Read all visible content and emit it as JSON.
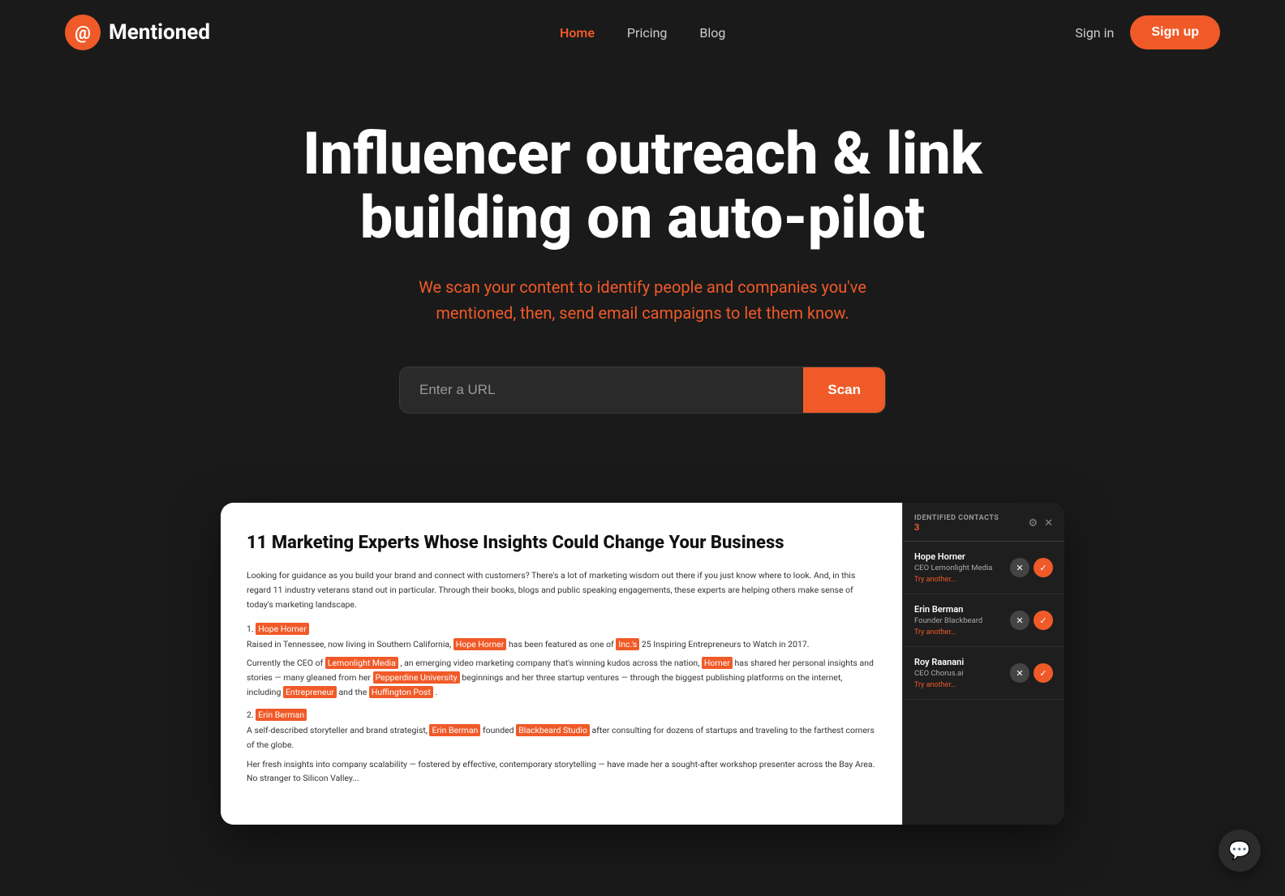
{
  "brand": {
    "logo_text": "Mentioned",
    "logo_icon_color": "#f05a28"
  },
  "nav": {
    "links": [
      {
        "label": "Home",
        "active": true
      },
      {
        "label": "Pricing",
        "active": false
      },
      {
        "label": "Blog",
        "active": false
      }
    ],
    "signin_label": "Sign in",
    "signup_label": "Sign up"
  },
  "hero": {
    "title": "Influencer outreach & link building on auto-pilot",
    "subtitle": "We scan your content to identify people and companies you've mentioned, then, send email campaigns to let them know."
  },
  "scan": {
    "placeholder": "Enter a URL",
    "button_label": "Scan"
  },
  "article": {
    "title": "11 Marketing Experts Whose Insights Could Change Your Business",
    "intro": "Looking for guidance as you build your brand and connect with customers? There's a lot of marketing wisdom out there if you just know where to look. And, in this regard 11 industry veterans stand out in particular. Through their books, blogs and public speaking engagements, these experts are helping others make sense of today's marketing landscape.",
    "persons": [
      {
        "num": "1.",
        "name": "Hope Horner",
        "title_company": "CEO Lemonlight Media",
        "bio_line1": "Raised in Tennessee, now living in Southern California,",
        "highlight1": "Hope Horner",
        "bio_line2": "has been featured as one of",
        "highlight2": "Inc.'s",
        "bio_line3": "25 Inspiring Entrepreneurs to Watch in 2017.",
        "bio_line4": "Currently the CEO of",
        "highlight3": "Lemonlight Media",
        "bio_line5": ", an emerging video marketing company that's winning kudos across the nation,",
        "highlight4": "Horner",
        "bio_line6": "has shared her personal insights and stories — many gleaned from her",
        "highlight5": "Pepperdine University",
        "bio_line7": "beginnings and her three startup ventures — through the biggest publishing platforms on the internet, including",
        "highlight6": "Entrepreneur",
        "bio_line8": "and the",
        "highlight7": "Huffington Post",
        "bio_line9": ".",
        "action": "Try another..."
      },
      {
        "num": "2.",
        "name": "Erin Berman",
        "title_company": "Founder Blackbeard Studio",
        "bio_line1": "A self-described storyteller and brand strategist,",
        "highlight1": "Erin Berman",
        "bio_line2": "founded",
        "highlight2": "Blackbeard Studio",
        "bio_line3": "after consulting for dozens of startups and traveling to the farthest corners of the globe.",
        "bio_line4": "Her fresh insights into company scalability — fostered by effective, contemporary storytelling — have made her a sought-after workshop presenter across the Bay Area. No stranger to Silicon Valley...",
        "action": "Try another..."
      }
    ]
  },
  "panel": {
    "header_title": "IDENTIFIED CONTACTS",
    "count": "3",
    "contacts": [
      {
        "name": "Hope Horner",
        "title": "CEO Lemonlight Media",
        "action": "Try another..."
      },
      {
        "name": "Erin Berman",
        "title": "Founder Blackbeard",
        "action": "Try another..."
      },
      {
        "name": "Roy Raanani",
        "title": "CEO Chorus.ai",
        "action": "Try another..."
      }
    ]
  },
  "chat": {
    "icon": "💬"
  }
}
